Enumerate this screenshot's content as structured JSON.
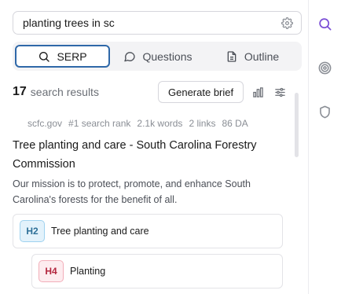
{
  "search": {
    "query": "planting trees in sc"
  },
  "tabs": [
    {
      "label": "SERP",
      "icon": "search-icon",
      "active": true
    },
    {
      "label": "Questions",
      "icon": "chat-bubble-icon",
      "active": false
    },
    {
      "label": "Outline",
      "icon": "document-icon",
      "active": false
    }
  ],
  "results": {
    "count": "17",
    "label": "search results",
    "brief_button": "Generate brief"
  },
  "result": {
    "domain": "scfc.gov",
    "rank": "#1 search rank",
    "words": "2.1k words",
    "links": "2 links",
    "da": "86 DA",
    "title": "Tree planting and care - South Carolina Forestry Commission",
    "snippet": "Our mission is to protect, promote, and enhance South Carolina's forests for the benefit of all."
  },
  "headings": [
    {
      "tag": "H2",
      "text": "Tree planting and care"
    },
    {
      "tag": "H4",
      "text": "Planting"
    }
  ],
  "colors": {
    "accent": "#2f68a8",
    "rail_active": "#7b4fd6",
    "h2_tag": "#2d6f97",
    "h4_tag": "#b3263e"
  }
}
